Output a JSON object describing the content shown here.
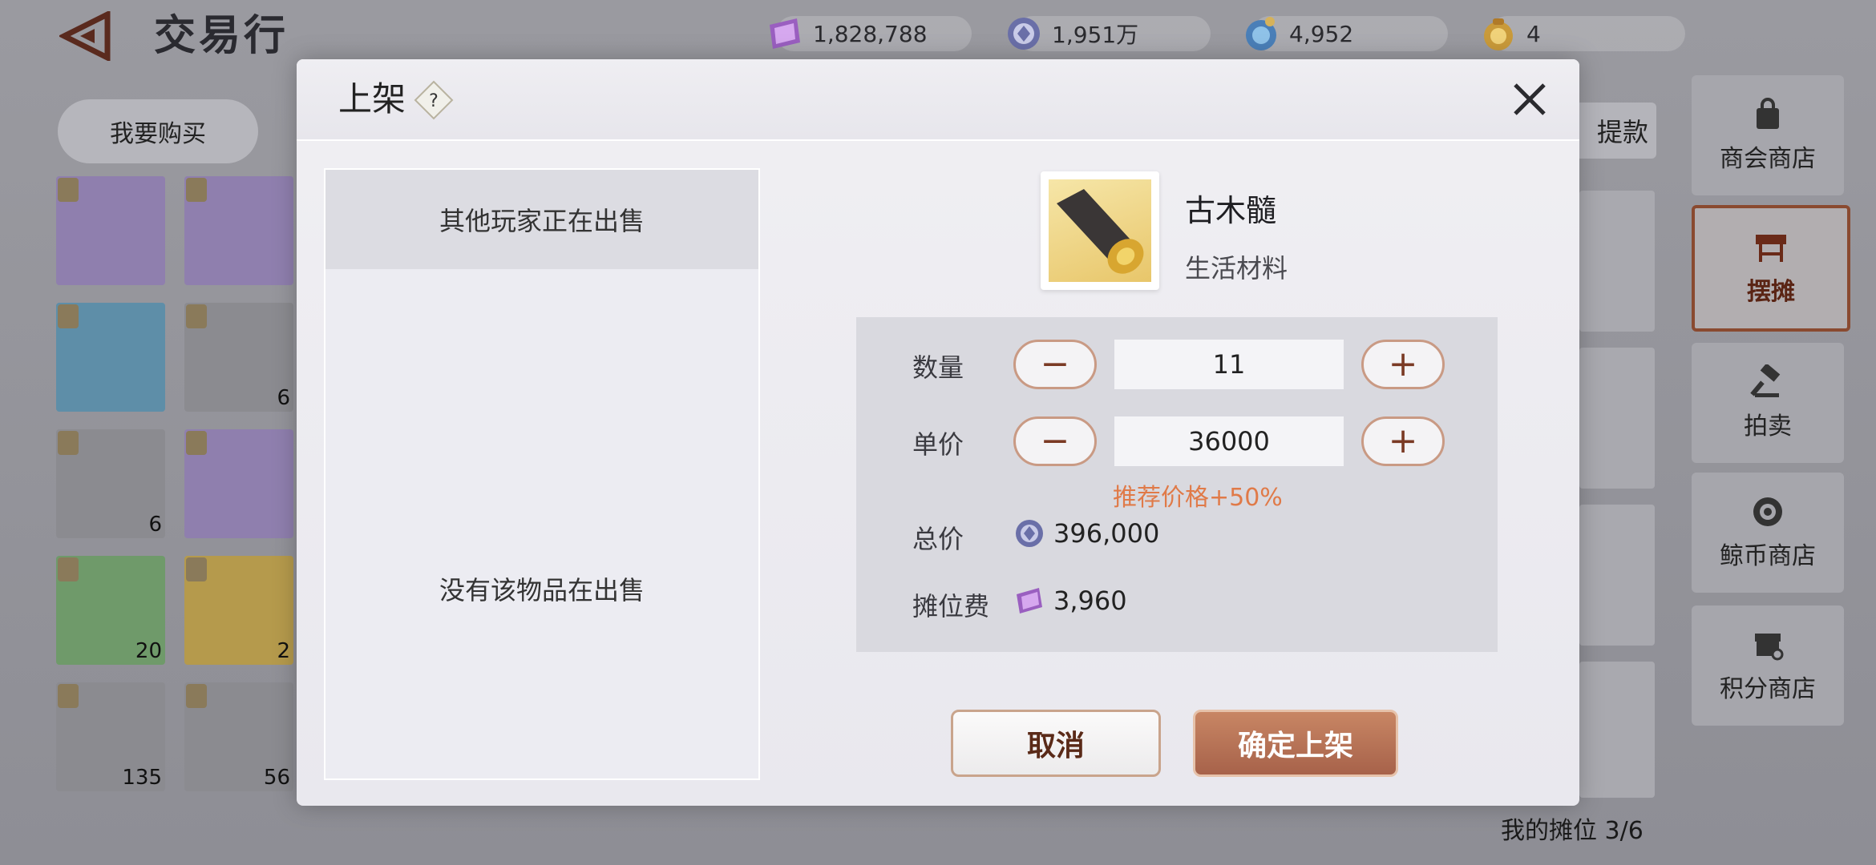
{
  "header": {
    "title": "交易行"
  },
  "currencies": [
    {
      "icon": "purple-ticket-icon",
      "value": "1,828,788"
    },
    {
      "icon": "silver-coin-icon",
      "value": "1,951万"
    },
    {
      "icon": "whale-coin-icon",
      "value": "4,952"
    },
    {
      "icon": "gold-pouch-icon",
      "value": "4"
    }
  ],
  "tabs": {
    "buy": "我要购买"
  },
  "withdraw_label": "提款",
  "inventory": [
    {
      "name": "gloves-icon",
      "count": "",
      "bg": "#8f7fae"
    },
    {
      "name": "crystal-icon",
      "count": "",
      "bg": "#8f7fae"
    },
    {
      "name": "scroll-icon",
      "count": "",
      "bg": "#5e8ea8"
    },
    {
      "name": "cloth-icon",
      "count": "6",
      "bg": "#8b8b90"
    },
    {
      "name": "bowl-icon",
      "count": "6",
      "bg": "#8b8b90"
    },
    {
      "name": "emblem-icon",
      "count": "",
      "bg": "#8f7fae"
    },
    {
      "name": "bag-icon",
      "count": "20",
      "bg": "#6f9a6a"
    },
    {
      "name": "potion-icon",
      "count": "2",
      "bg": "#b59a4c"
    },
    {
      "name": "wood-icon",
      "count": "135",
      "bg": "#8b8b90"
    },
    {
      "name": "ore-icon",
      "count": "56",
      "bg": "#8b8b90"
    }
  ],
  "sidebar": [
    {
      "label": "商会商店",
      "icon": "shop-bag-icon"
    },
    {
      "label": "摆摊",
      "icon": "stall-icon",
      "active": true
    },
    {
      "label": "拍卖",
      "icon": "gavel-icon"
    },
    {
      "label": "鲸币商店",
      "icon": "whale-icon"
    },
    {
      "label": "积分商店",
      "icon": "store-icon"
    }
  ],
  "my_slots": "我的摊位 3/6",
  "dialog": {
    "title": "上架",
    "help_symbol": "?",
    "left_tab": "其他玩家正在出售",
    "empty_message": "没有该物品在出售",
    "item": {
      "name": "古木髓",
      "type": "生活材料"
    },
    "quantity": {
      "label": "数量",
      "value": "11"
    },
    "unit_price": {
      "label": "单价",
      "value": "36000"
    },
    "stepper": {
      "minus": "−",
      "plus": "+"
    },
    "recommendation": "推荐价格+50%",
    "total": {
      "label": "总价",
      "value": "396,000"
    },
    "fee": {
      "label": "摊位费",
      "value": "3,960"
    },
    "cancel_label": "取消",
    "confirm_label": "确定上架"
  },
  "colors": {
    "accent": "#a7624a",
    "recommend": "#e07a48"
  }
}
